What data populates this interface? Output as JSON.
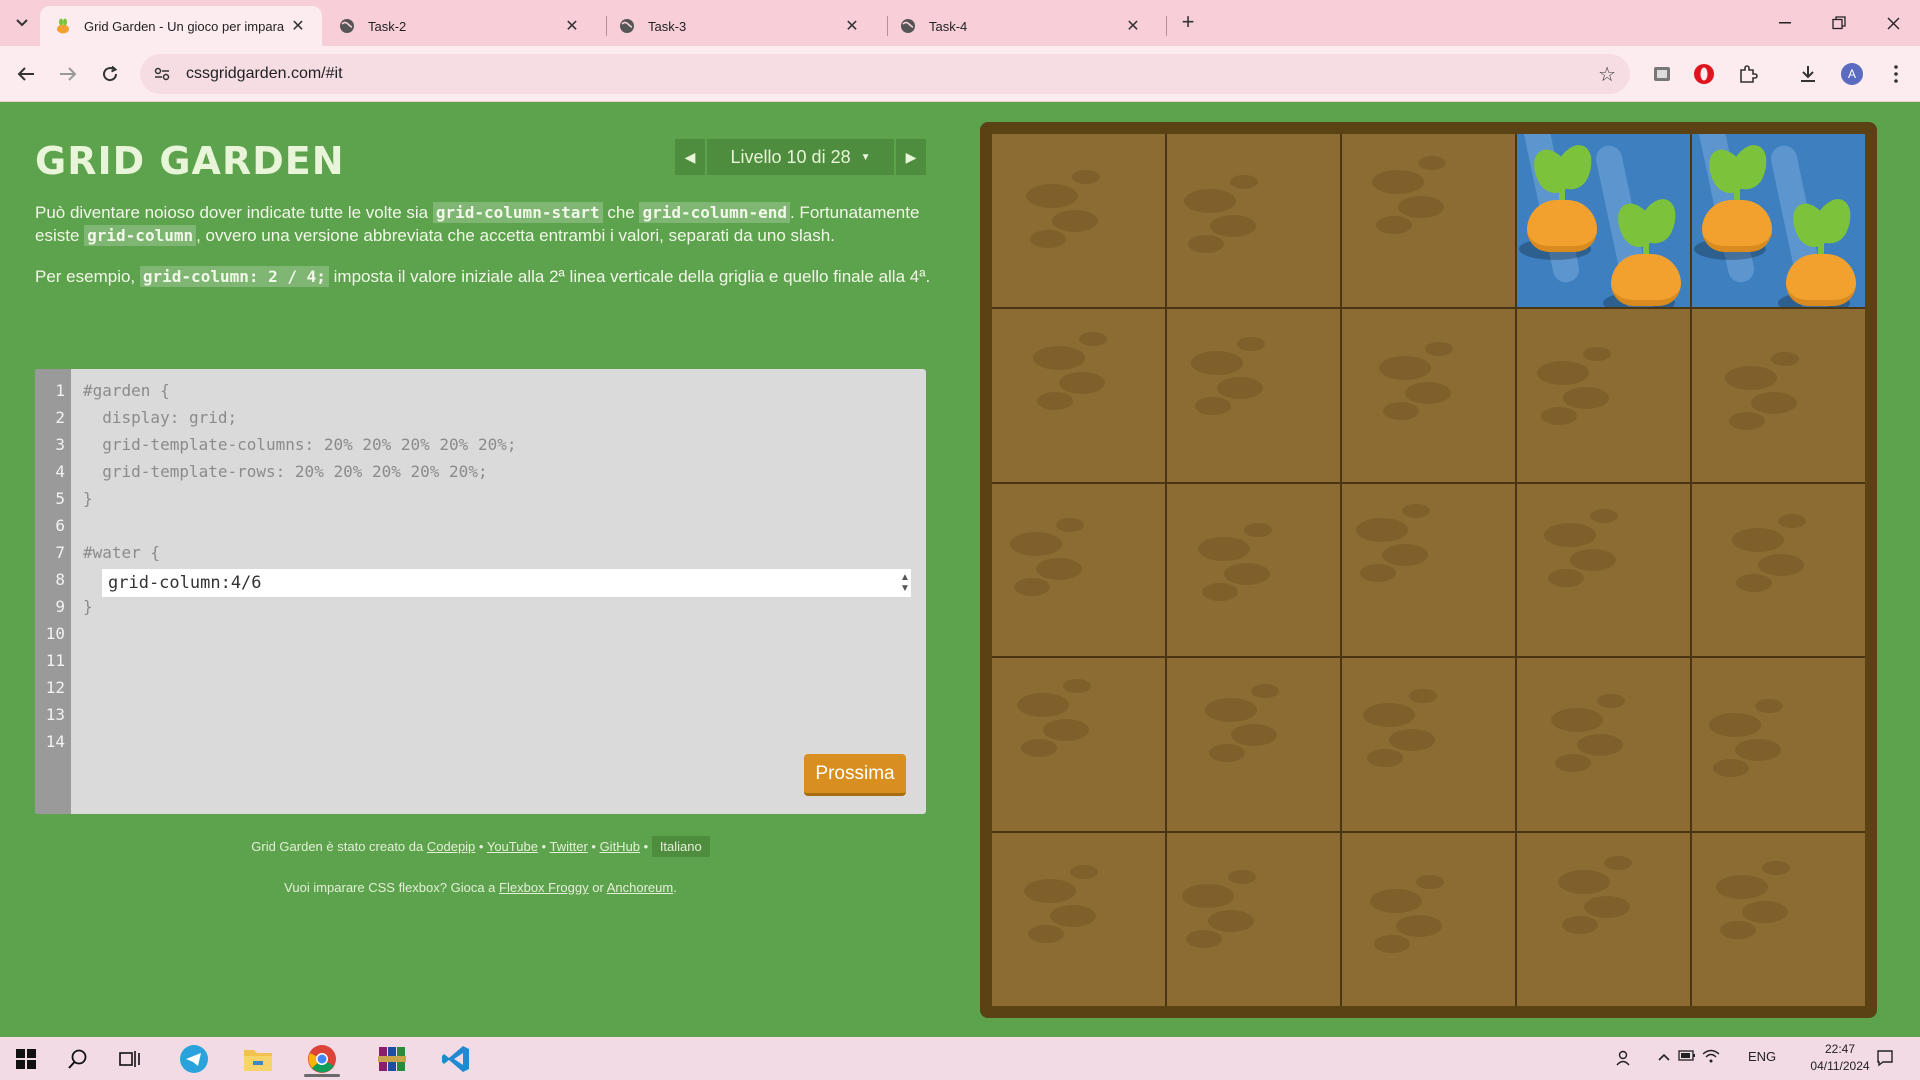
{
  "browser": {
    "tabs": [
      {
        "title": "Grid Garden - Un gioco per impara",
        "active": true
      },
      {
        "title": "Task-2",
        "active": false
      },
      {
        "title": "Task-3",
        "active": false
      },
      {
        "title": "Task-4",
        "active": false
      }
    ],
    "url": "cssgridgarden.com/#it",
    "profile_initial": "A"
  },
  "page": {
    "logo": "GRID GARDEN",
    "level_label": "Livello 10 di 28",
    "instructions": {
      "p1_a": "Può diventare noioso dover indicate tutte le volte sia ",
      "p1_code1": "grid-column-start",
      "p1_b": " che ",
      "p1_code2": "grid-column-end",
      "p1_c": ". Fortunatamente esiste ",
      "p1_code3": "grid-column",
      "p1_d": ", ovvero una versione abbreviata che accetta entrambi i valori, separati da uno slash.",
      "p2_a": "Per esempio, ",
      "p2_code": "grid-column: 2 / 4;",
      "p2_b": " imposta il valore iniziale alla 2ª linea verticale della griglia e quello finale alla 4ª."
    },
    "editor": {
      "line_numbers": [
        "1",
        "2",
        "3",
        "4",
        "5",
        "6",
        "7",
        "8",
        "9",
        "10",
        "11",
        "12",
        "13",
        "14"
      ],
      "lines": [
        "#garden {",
        "  display: grid;",
        "  grid-template-columns: 20% 20% 20% 20% 20%;",
        "  grid-template-rows: 20% 20% 20% 20% 20%;",
        "}",
        "",
        "#water {",
        "",
        "}"
      ],
      "input_value": "grid-column:4/6",
      "next_button": "Prossima"
    },
    "footer": {
      "created_by": "Grid Garden è stato creato da",
      "link_codepip": "Codepip",
      "link_youtube": "YouTube",
      "link_twitter": "Twitter",
      "link_github": "GitHub",
      "language": "Italiano",
      "learn_prefix": "Vuoi imparare CSS flexbox? Gioca a",
      "link_froggy": "Flexbox Froggy",
      "or": "or",
      "link_anchoreum": "Anchoreum"
    }
  },
  "taskbar": {
    "lang": "ENG",
    "time": "22:47",
    "date": "04/11/2024"
  },
  "colors": {
    "page_bg": "#5da24c",
    "soil": "#8c6c32",
    "water": "#3d7fbf",
    "button": "#d88f20"
  }
}
